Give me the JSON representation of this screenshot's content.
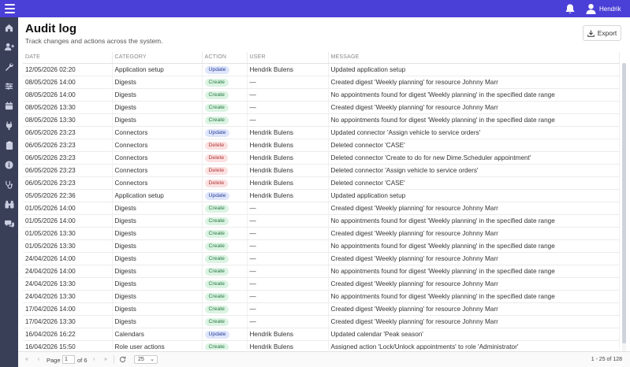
{
  "header": {
    "user_name": "Hendrik"
  },
  "sidebar": {
    "items": [
      "home-icon",
      "users-icon",
      "wrench-icon",
      "sliders-icon",
      "calendar-icon",
      "plug-icon",
      "clipboard-icon",
      "info-icon",
      "stethoscope-icon",
      "binoculars-icon",
      "chat-icon"
    ]
  },
  "page": {
    "title": "Audit log",
    "subtitle": "Track changes and actions across the system.",
    "export_label": "Export"
  },
  "table": {
    "columns": [
      "DATE",
      "CATEGORY",
      "ACTION",
      "USER",
      "MESSAGE"
    ],
    "rows": [
      {
        "date": "12/05/2026 02:20",
        "category": "Application setup",
        "action": "Update",
        "user": "Hendrik Bulens",
        "message": "Updated application setup"
      },
      {
        "date": "08/05/2026 14:00",
        "category": "Digests",
        "action": "Create",
        "user": "—",
        "message": "Created digest 'Weekly planning' for resource Johnny Marr"
      },
      {
        "date": "08/05/2026 14:00",
        "category": "Digests",
        "action": "Create",
        "user": "—",
        "message": "No appointments found for digest 'Weekly planning' in the specified date range"
      },
      {
        "date": "08/05/2026 13:30",
        "category": "Digests",
        "action": "Create",
        "user": "—",
        "message": "Created digest 'Weekly planning' for resource Johnny Marr"
      },
      {
        "date": "08/05/2026 13:30",
        "category": "Digests",
        "action": "Create",
        "user": "—",
        "message": "No appointments found for digest 'Weekly planning' in the specified date range"
      },
      {
        "date": "06/05/2026 23:23",
        "category": "Connectors",
        "action": "Update",
        "user": "Hendrik Bulens",
        "message": "Updated connector 'Assign vehicle to service orders'"
      },
      {
        "date": "06/05/2026 23:23",
        "category": "Connectors",
        "action": "Delete",
        "user": "Hendrik Bulens",
        "message": "Deleted connector 'CASE'"
      },
      {
        "date": "06/05/2026 23:23",
        "category": "Connectors",
        "action": "Delete",
        "user": "Hendrik Bulens",
        "message": "Deleted connector 'Create to do for new Dime.Scheduler appointment'"
      },
      {
        "date": "06/05/2026 23:23",
        "category": "Connectors",
        "action": "Delete",
        "user": "Hendrik Bulens",
        "message": "Deleted connector 'Assign vehicle to service orders'"
      },
      {
        "date": "06/05/2026 23:23",
        "category": "Connectors",
        "action": "Delete",
        "user": "Hendrik Bulens",
        "message": "Deleted connector 'CASE'"
      },
      {
        "date": "05/05/2026 22:36",
        "category": "Application setup",
        "action": "Update",
        "user": "Hendrik Bulens",
        "message": "Updated application setup"
      },
      {
        "date": "01/05/2026 14:00",
        "category": "Digests",
        "action": "Create",
        "user": "—",
        "message": "Created digest 'Weekly planning' for resource Johnny Marr"
      },
      {
        "date": "01/05/2026 14:00",
        "category": "Digests",
        "action": "Create",
        "user": "—",
        "message": "No appointments found for digest 'Weekly planning' in the specified date range"
      },
      {
        "date": "01/05/2026 13:30",
        "category": "Digests",
        "action": "Create",
        "user": "—",
        "message": "Created digest 'Weekly planning' for resource Johnny Marr"
      },
      {
        "date": "01/05/2026 13:30",
        "category": "Digests",
        "action": "Create",
        "user": "—",
        "message": "No appointments found for digest 'Weekly planning' in the specified date range"
      },
      {
        "date": "24/04/2026 14:00",
        "category": "Digests",
        "action": "Create",
        "user": "—",
        "message": "Created digest 'Weekly planning' for resource Johnny Marr"
      },
      {
        "date": "24/04/2026 14:00",
        "category": "Digests",
        "action": "Create",
        "user": "—",
        "message": "No appointments found for digest 'Weekly planning' in the specified date range"
      },
      {
        "date": "24/04/2026 13:30",
        "category": "Digests",
        "action": "Create",
        "user": "—",
        "message": "Created digest 'Weekly planning' for resource Johnny Marr"
      },
      {
        "date": "24/04/2026 13:30",
        "category": "Digests",
        "action": "Create",
        "user": "—",
        "message": "No appointments found for digest 'Weekly planning' in the specified date range"
      },
      {
        "date": "17/04/2026 14:00",
        "category": "Digests",
        "action": "Create",
        "user": "—",
        "message": "Created digest 'Weekly planning' for resource Johnny Marr"
      },
      {
        "date": "17/04/2026 13:30",
        "category": "Digests",
        "action": "Create",
        "user": "—",
        "message": "Created digest 'Weekly planning' for resource Johnny Marr"
      },
      {
        "date": "16/04/2026 16:22",
        "category": "Calendars",
        "action": "Update",
        "user": "Hendrik Bulens",
        "message": "Updated calendar 'Peak season'"
      },
      {
        "date": "16/04/2026 15:50",
        "category": "Role user actions",
        "action": "Create",
        "user": "Hendrik Bulens",
        "message": "Assigned action 'Lock/Unlock appointments' to role 'Administrator'"
      }
    ]
  },
  "pager": {
    "page_label": "Page",
    "page_value": "1",
    "of_label": "of 6",
    "page_size": "25",
    "count_label": "1 - 25 of 128"
  },
  "colors": {
    "topbar": "#4a3fd6",
    "sidebar": "#3a3f58"
  }
}
